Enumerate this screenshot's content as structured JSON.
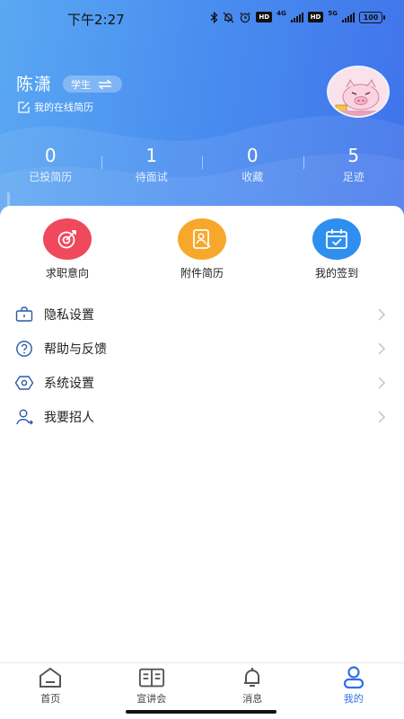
{
  "status_bar": {
    "time": "下午2:27",
    "net_4g": "4G",
    "net_5g": "5G",
    "hd": "HD",
    "battery": "100"
  },
  "profile": {
    "name": "陈潇",
    "role": "学生",
    "resume_link": "我的在线简历"
  },
  "stats": [
    {
      "value": "0",
      "label": "已投简历"
    },
    {
      "value": "1",
      "label": "待面试"
    },
    {
      "value": "0",
      "label": "收藏"
    },
    {
      "value": "5",
      "label": "足迹"
    }
  ],
  "quick_actions": [
    {
      "label": "求职意向",
      "icon": "target-icon",
      "color": "#f0485c"
    },
    {
      "label": "附件简历",
      "icon": "document-person-icon",
      "color": "#f7a82c"
    },
    {
      "label": "我的签到",
      "icon": "calendar-check-icon",
      "color": "#2f8ff0"
    }
  ],
  "menu": [
    {
      "label": "隐私设置",
      "icon": "privacy-icon"
    },
    {
      "label": "帮助与反馈",
      "icon": "help-icon"
    },
    {
      "label": "系统设置",
      "icon": "settings-icon"
    },
    {
      "label": "我要招人",
      "icon": "recruit-icon"
    }
  ],
  "tabs": [
    {
      "label": "首页",
      "icon": "home-icon",
      "active": false
    },
    {
      "label": "宣讲会",
      "icon": "book-icon",
      "active": false
    },
    {
      "label": "消息",
      "icon": "bell-icon",
      "active": false
    },
    {
      "label": "我的",
      "icon": "user-icon",
      "active": true
    }
  ],
  "colors": {
    "header_start": "#5aa8f2",
    "header_end": "#3f72ea",
    "active_tab": "#2f6fea"
  }
}
